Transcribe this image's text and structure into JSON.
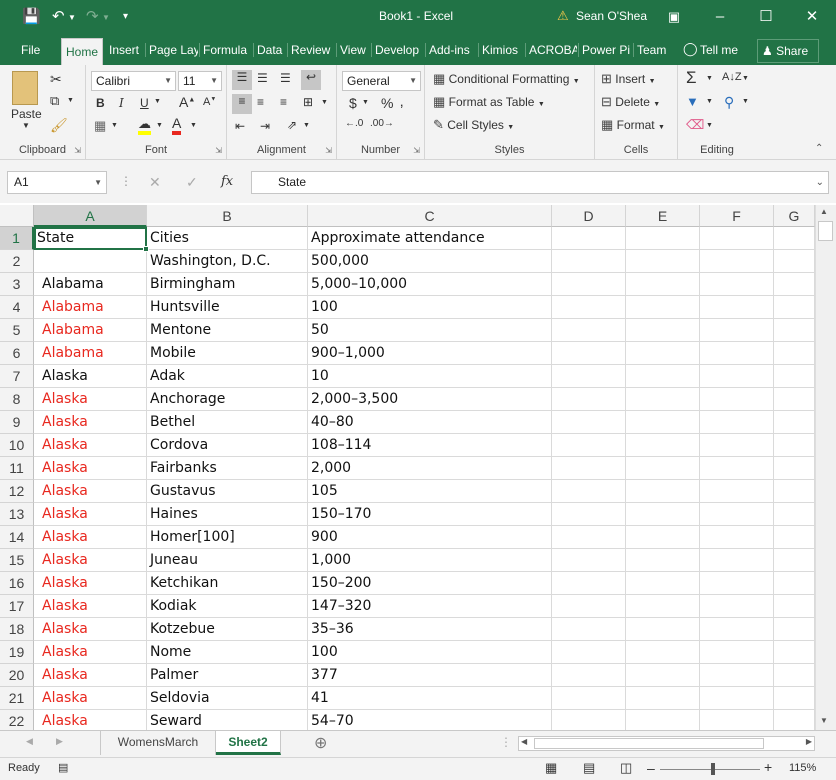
{
  "titlebar": {
    "title": "Book1  -  Excel",
    "user": "Sean O'Shea",
    "warning_icon": "warning-icon"
  },
  "tabs": [
    {
      "label": "File"
    },
    {
      "label": "Home"
    },
    {
      "label": "Insert"
    },
    {
      "label": "Page Lay"
    },
    {
      "label": "Formula"
    },
    {
      "label": "Data"
    },
    {
      "label": "Review"
    },
    {
      "label": "View"
    },
    {
      "label": "Develop"
    },
    {
      "label": "Add-ins"
    },
    {
      "label": "Kimios"
    },
    {
      "label": "ACROBA"
    },
    {
      "label": "Power Pi"
    },
    {
      "label": "Team"
    },
    {
      "label": "Tell me"
    },
    {
      "label": "Share"
    }
  ],
  "ribbon": {
    "clipboard": {
      "label": "Clipboard",
      "paste": "Paste"
    },
    "font": {
      "label": "Font",
      "family": "Calibri",
      "size": "11"
    },
    "alignment": {
      "label": "Alignment"
    },
    "number": {
      "label": "Number",
      "format": "General"
    },
    "styles": {
      "label": "Styles",
      "conditional": "Conditional Formatting",
      "format_table": "Format as Table",
      "cell_styles": "Cell Styles"
    },
    "cells": {
      "label": "Cells",
      "insert": "Insert",
      "delete": "Delete",
      "format": "Format"
    },
    "editing": {
      "label": "Editing"
    }
  },
  "formula_bar": {
    "name_box": "A1",
    "fx": "fx",
    "content": "State"
  },
  "columns": [
    "A",
    "B",
    "C",
    "D",
    "E",
    "F",
    "G"
  ],
  "rows": [
    {
      "n": "1",
      "a": "State",
      "b": "Cities",
      "c": "Approximate attendance",
      "red": false
    },
    {
      "n": "2",
      "a": "",
      "b": " Washington, D.C.",
      "c": "500,000",
      "red": false
    },
    {
      "n": "3",
      "a": "Alabama",
      "b": "Birmingham",
      "c": "5,000–10,000",
      "red": false
    },
    {
      "n": "4",
      "a": "Alabama",
      "b": "Huntsville",
      "c": "100",
      "red": true
    },
    {
      "n": "5",
      "a": "Alabama",
      "b": "Mentone",
      "c": "50",
      "red": true
    },
    {
      "n": "6",
      "a": "Alabama",
      "b": "Mobile",
      "c": "900–1,000",
      "red": true
    },
    {
      "n": "7",
      "a": "Alaska",
      "b": "Adak",
      "c": "10",
      "red": false
    },
    {
      "n": "8",
      "a": "Alaska",
      "b": "Anchorage",
      "c": "2,000–3,500",
      "red": true
    },
    {
      "n": "9",
      "a": "Alaska",
      "b": "Bethel",
      "c": "40–80",
      "red": true
    },
    {
      "n": "10",
      "a": "Alaska",
      "b": "Cordova",
      "c": "108–114",
      "red": true
    },
    {
      "n": "11",
      "a": "Alaska",
      "b": "Fairbanks",
      "c": "2,000",
      "red": true
    },
    {
      "n": "12",
      "a": "Alaska",
      "b": "Gustavus",
      "c": "105",
      "red": true
    },
    {
      "n": "13",
      "a": "Alaska",
      "b": "Haines",
      "c": "150–170",
      "red": true
    },
    {
      "n": "14",
      "a": "Alaska",
      "b": "Homer[100]",
      "c": "900",
      "red": true
    },
    {
      "n": "15",
      "a": "Alaska",
      "b": "Juneau",
      "c": "1,000",
      "red": true
    },
    {
      "n": "16",
      "a": "Alaska",
      "b": "Ketchikan",
      "c": "150–200",
      "red": true
    },
    {
      "n": "17",
      "a": "Alaska",
      "b": "Kodiak",
      "c": "147–320",
      "red": true
    },
    {
      "n": "18",
      "a": "Alaska",
      "b": "Kotzebue",
      "c": "35–36",
      "red": true
    },
    {
      "n": "19",
      "a": "Alaska",
      "b": "Nome",
      "c": "100",
      "red": true
    },
    {
      "n": "20",
      "a": "Alaska",
      "b": "Palmer",
      "c": "377",
      "red": true
    },
    {
      "n": "21",
      "a": "Alaska",
      "b": "Seldovia",
      "c": "41",
      "red": true
    },
    {
      "n": "22",
      "a": "Alaska",
      "b": "Seward",
      "c": "54–70",
      "red": true
    }
  ],
  "sheets": [
    {
      "label": "WomensMarch",
      "active": false
    },
    {
      "label": "Sheet2",
      "active": true
    }
  ],
  "status": {
    "ready": "Ready",
    "zoom": "115%"
  },
  "colors": {
    "excel_green": "#217346",
    "red_text": "#e8281f"
  }
}
